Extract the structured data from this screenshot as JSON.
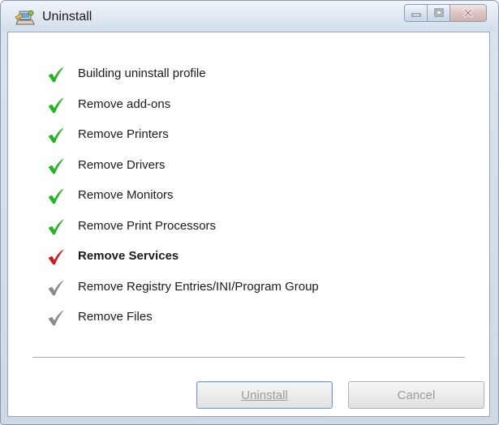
{
  "window": {
    "title": "Uninstall",
    "icon": "uninstall-computer-icon"
  },
  "caption_buttons": {
    "minimize_icon": "minimize-icon",
    "maximize_icon": "maximize-icon",
    "close_icon": "close-icon"
  },
  "steps": [
    {
      "label": "Building uninstall profile",
      "status": "done",
      "icon": "check-icon",
      "color": "#22b422"
    },
    {
      "label": "Remove add-ons",
      "status": "done",
      "icon": "check-icon",
      "color": "#22b422"
    },
    {
      "label": "Remove Printers",
      "status": "done",
      "icon": "check-icon",
      "color": "#22b422"
    },
    {
      "label": "Remove Drivers",
      "status": "done",
      "icon": "check-icon",
      "color": "#22b422"
    },
    {
      "label": "Remove Monitors",
      "status": "done",
      "icon": "check-icon",
      "color": "#22b422"
    },
    {
      "label": "Remove Print Processors",
      "status": "done",
      "icon": "check-icon",
      "color": "#22b422"
    },
    {
      "label": "Remove Services",
      "status": "current",
      "icon": "check-icon",
      "color": "#cc1c1c"
    },
    {
      "label": "Remove Registry Entries/INI/Program Group",
      "status": "pending",
      "icon": "check-icon",
      "color": "#8a8a8a"
    },
    {
      "label": "Remove Files",
      "status": "pending",
      "icon": "check-icon",
      "color": "#8a8a8a"
    }
  ],
  "buttons": {
    "uninstall_label": "Uninstall",
    "cancel_label": "Cancel"
  }
}
